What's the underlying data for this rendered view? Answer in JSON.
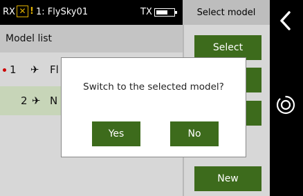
{
  "status": {
    "rx_label": "RX",
    "alert_glyph": "!",
    "model_name": "1: FlySky01",
    "tx_label": "TX"
  },
  "page_title": "Select model",
  "list": {
    "header": "Model list",
    "rows": [
      {
        "num": "1",
        "name": "Fl",
        "active": true
      },
      {
        "num": "2",
        "name": "N",
        "active": false
      }
    ]
  },
  "side_buttons": {
    "select": "Select",
    "new": "New"
  },
  "dialog": {
    "message": "Switch to the selected model?",
    "yes": "Yes",
    "no": "No"
  },
  "colors": {
    "accent_green": "#3d6b1c",
    "selected_row": "#c7d5b8",
    "warning": "#e0b000",
    "active_dot": "#cc0000"
  },
  "icons": [
    "rx-error-icon",
    "warning-icon",
    "battery-icon",
    "airplane-icon",
    "back-chevron-icon",
    "home-circle-icon"
  ]
}
